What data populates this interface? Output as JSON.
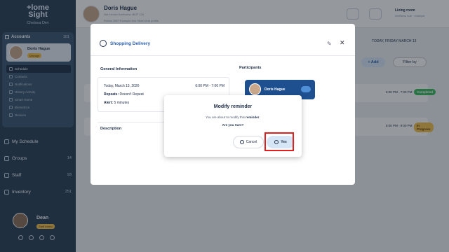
{
  "sidebar": {
    "brand": "+lome\nSight",
    "org": "Chelsea Dev",
    "accounts": {
      "label": "Accounts",
      "count": "101"
    },
    "active_account": {
      "name": "Doris Hague",
      "badge": "Manage"
    },
    "menu": [
      {
        "label": "Schedule"
      },
      {
        "label": "Contacts"
      },
      {
        "label": "Notifications"
      },
      {
        "label": "History Activity"
      },
      {
        "label": "Smart Home"
      },
      {
        "label": "Biometrics"
      },
      {
        "label": "Devices"
      }
    ],
    "nav": [
      {
        "label": "My Schedule",
        "count": ""
      },
      {
        "label": "Groups",
        "count": "14"
      },
      {
        "label": "Staff",
        "count": "93"
      },
      {
        "label": "Inventory",
        "count": "251"
      }
    ],
    "user": {
      "name": "Dean",
      "badge": "Staff Admin"
    }
  },
  "header": {
    "name": "Doris Hague",
    "meta": "Not Known   Northview   LB2F 12A",
    "meta2": "Rohan    1567 Example Ave Street   Add profile",
    "location": "Living room",
    "location_sub": "Wellness hub · example"
  },
  "background": {
    "date_label": "TODAY, FRIDAY MARCH 13",
    "add_label": "+ Add",
    "filter_label": "Filter by",
    "rows": [
      {
        "time": "6:00 PM - 7:00 PM",
        "status": "Completed",
        "color": "#3dbb5d"
      },
      {
        "time": "8:00 PM - 9:00 PM",
        "status": "In Progress",
        "color": "#f5c04b"
      }
    ]
  },
  "modal": {
    "title": "Shopping Delivery",
    "general_info": "General Information",
    "participants": "Participants",
    "date": "Today, March 13, 2026",
    "time": "6:00 PM - 7:00 PM",
    "repeats_label": "Repeats:",
    "repeats_value": "Doesn't Repeat",
    "alert_label": "Alert:",
    "alert_value": "5 minutes",
    "description": "Description",
    "participant_name": "Doris Hague"
  },
  "dialog": {
    "title": "Modify reminder",
    "message_pre": "You are about to modify this ",
    "message_bold": "reminder",
    "message_post": ".",
    "confirm": "Are you Sure?",
    "cancel_label": "Cancel",
    "yes_label": "Yes"
  },
  "colors": {
    "sidebar": "#2a3e55",
    "accent": "#2a5ea8",
    "highlight": "#e02020"
  }
}
